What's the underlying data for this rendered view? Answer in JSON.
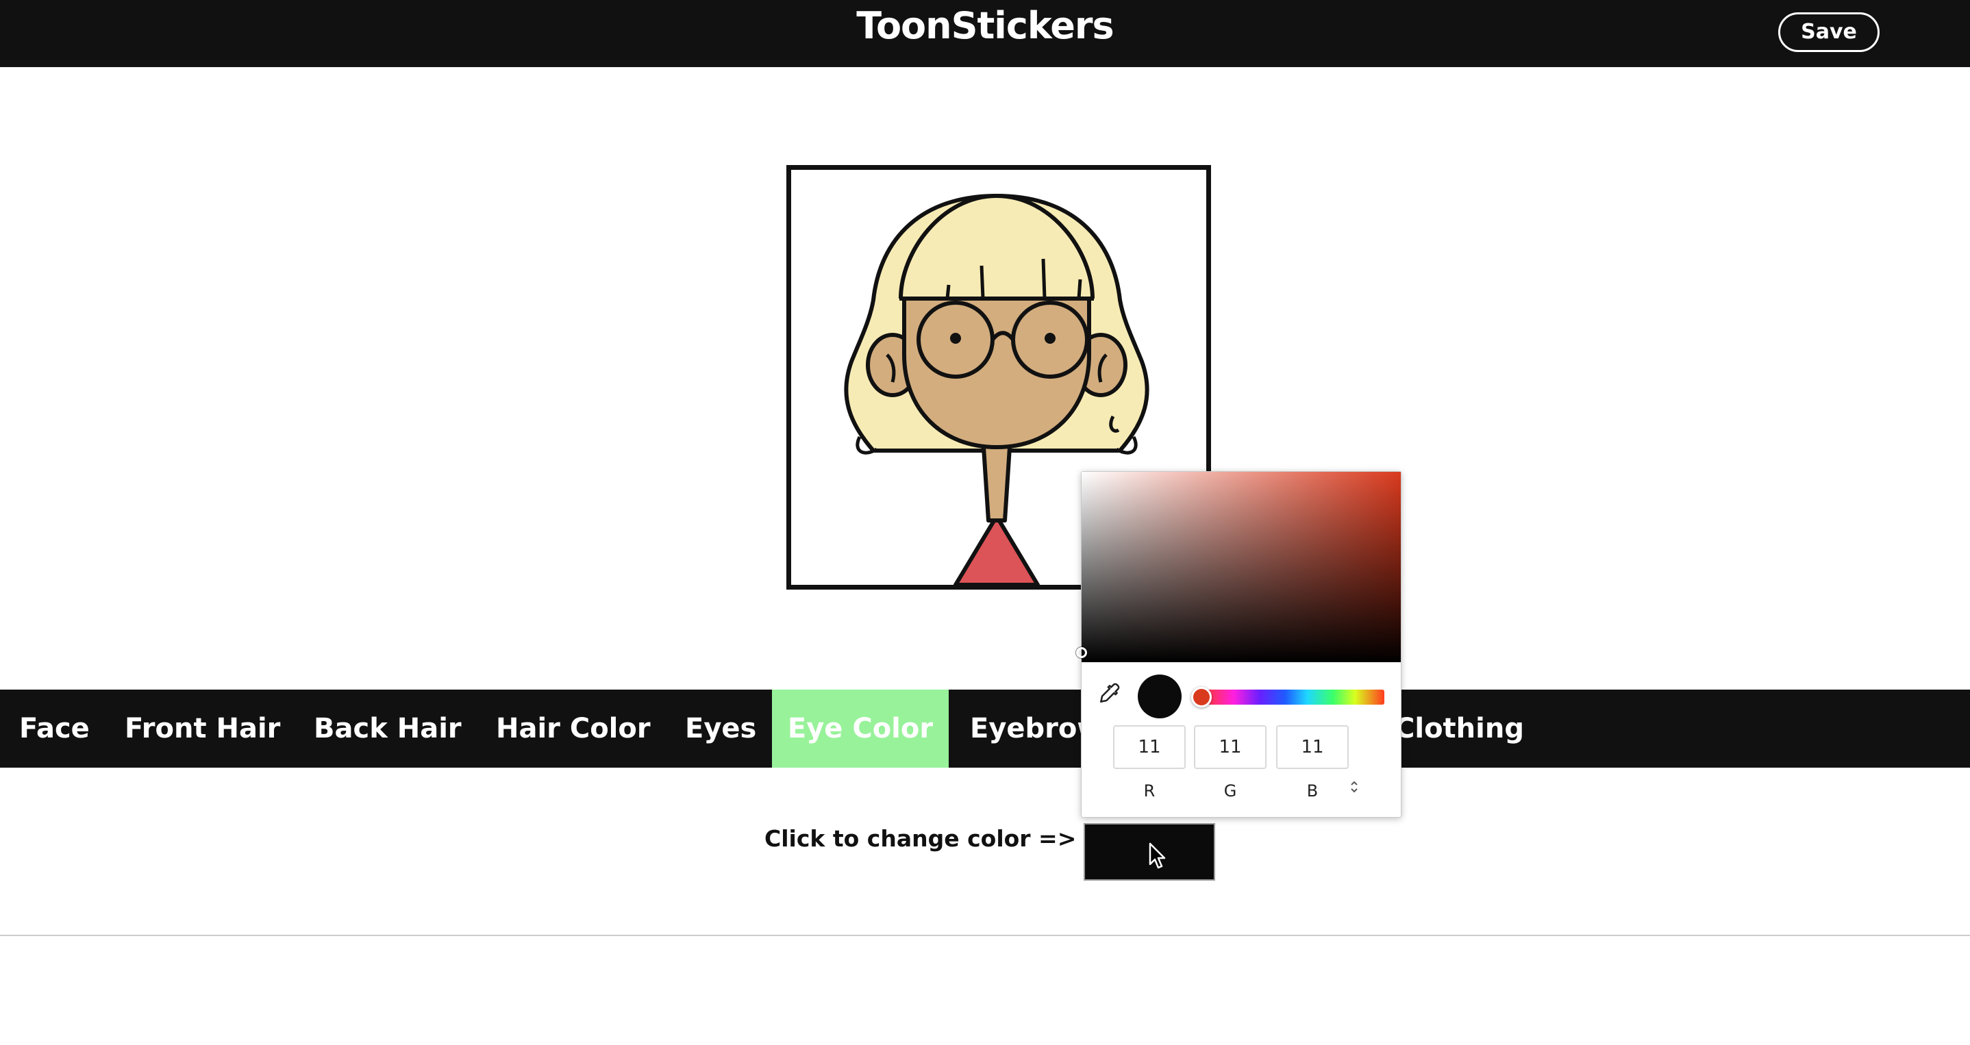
{
  "header": {
    "title": "ToonStickers",
    "save_label": "Save"
  },
  "tabs": [
    {
      "label": "Face",
      "active": false
    },
    {
      "label": "Front Hair",
      "active": false
    },
    {
      "label": "Back Hair",
      "active": false
    },
    {
      "label": "Hair Color",
      "active": false
    },
    {
      "label": "Eyes",
      "active": false
    },
    {
      "label": "Eye Color",
      "active": true
    },
    {
      "label": "Eyebrows",
      "active": false
    },
    {
      "label": "Clothing",
      "active": false
    }
  ],
  "color_section": {
    "prompt": "Click to change color =>",
    "current_color": "#0b0b0b"
  },
  "color_picker": {
    "hue_color": "#d93a1e",
    "r": "11",
    "g": "11",
    "b": "11",
    "r_label": "R",
    "g_label": "G",
    "b_label": "B"
  },
  "colors": {
    "header_bg": "#111111",
    "active_tab": "#98f29a",
    "hair": "#f7ebb5",
    "skin": "#d3ad7e",
    "shirt": "#dc5458"
  },
  "icons": [
    "eyedropper-icon",
    "cursor-pointer-icon",
    "chevron-updown-icon"
  ]
}
